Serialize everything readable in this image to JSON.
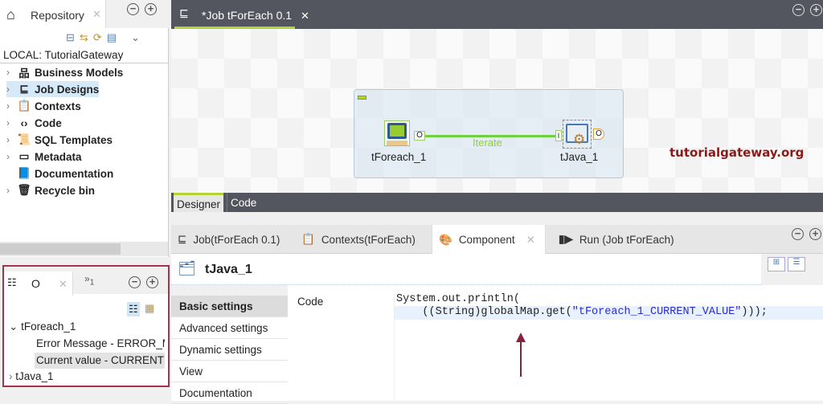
{
  "repository": {
    "tab_label": "Repository",
    "root": "LOCAL: TutorialGateway",
    "items": [
      {
        "label": "Business Models",
        "icon": "hierarchy-icon"
      },
      {
        "label": "Job Designs",
        "icon": "job-icon"
      },
      {
        "label": "Contexts",
        "icon": "contexts-icon"
      },
      {
        "label": "Code",
        "icon": "code-icon"
      },
      {
        "label": "SQL Templates",
        "icon": "sql-icon"
      },
      {
        "label": "Metadata",
        "icon": "metadata-icon"
      },
      {
        "label": "Documentation",
        "icon": "book-icon"
      },
      {
        "label": "Recycle bin",
        "icon": "trash-icon"
      }
    ]
  },
  "outline": {
    "tab_label": "O",
    "overflow_count": "1",
    "nodes": [
      {
        "label": "tForeach_1",
        "children": [
          "Error Message - ERROR_M",
          "Current value - CURRENT"
        ]
      },
      {
        "label": "tJava_1"
      }
    ]
  },
  "editor": {
    "tab_label": "*Job tForEach 0.1",
    "bottom_tabs": [
      "Designer",
      "Code"
    ],
    "components": {
      "a": "tForeach_1",
      "b": "tJava_1"
    },
    "link_label": "Iterate",
    "watermark": "tutorialgateway.org",
    "port_out": "O",
    "port_in": "I"
  },
  "bottom": {
    "tabs": [
      "Job(tForEach 0.1)",
      "Contexts(tForEach)",
      "Component",
      "Run (Job tForEach)"
    ],
    "active_tab": "Component",
    "component_title": "tJava_1",
    "vtabs": [
      "Basic settings",
      "Advanced settings",
      "Dynamic settings",
      "View",
      "Documentation"
    ],
    "code_label": "Code",
    "code_line1": "System.out.println(",
    "code_line2_prefix": "    ((String)globalMap.get(",
    "code_line2_string": "\"tForeach_1_CURRENT_VALUE\"",
    "code_line2_suffix": ")));"
  },
  "colors": {
    "accent": "#b5d334",
    "dark": "#53565f",
    "highlight_box": "#a3334f"
  }
}
